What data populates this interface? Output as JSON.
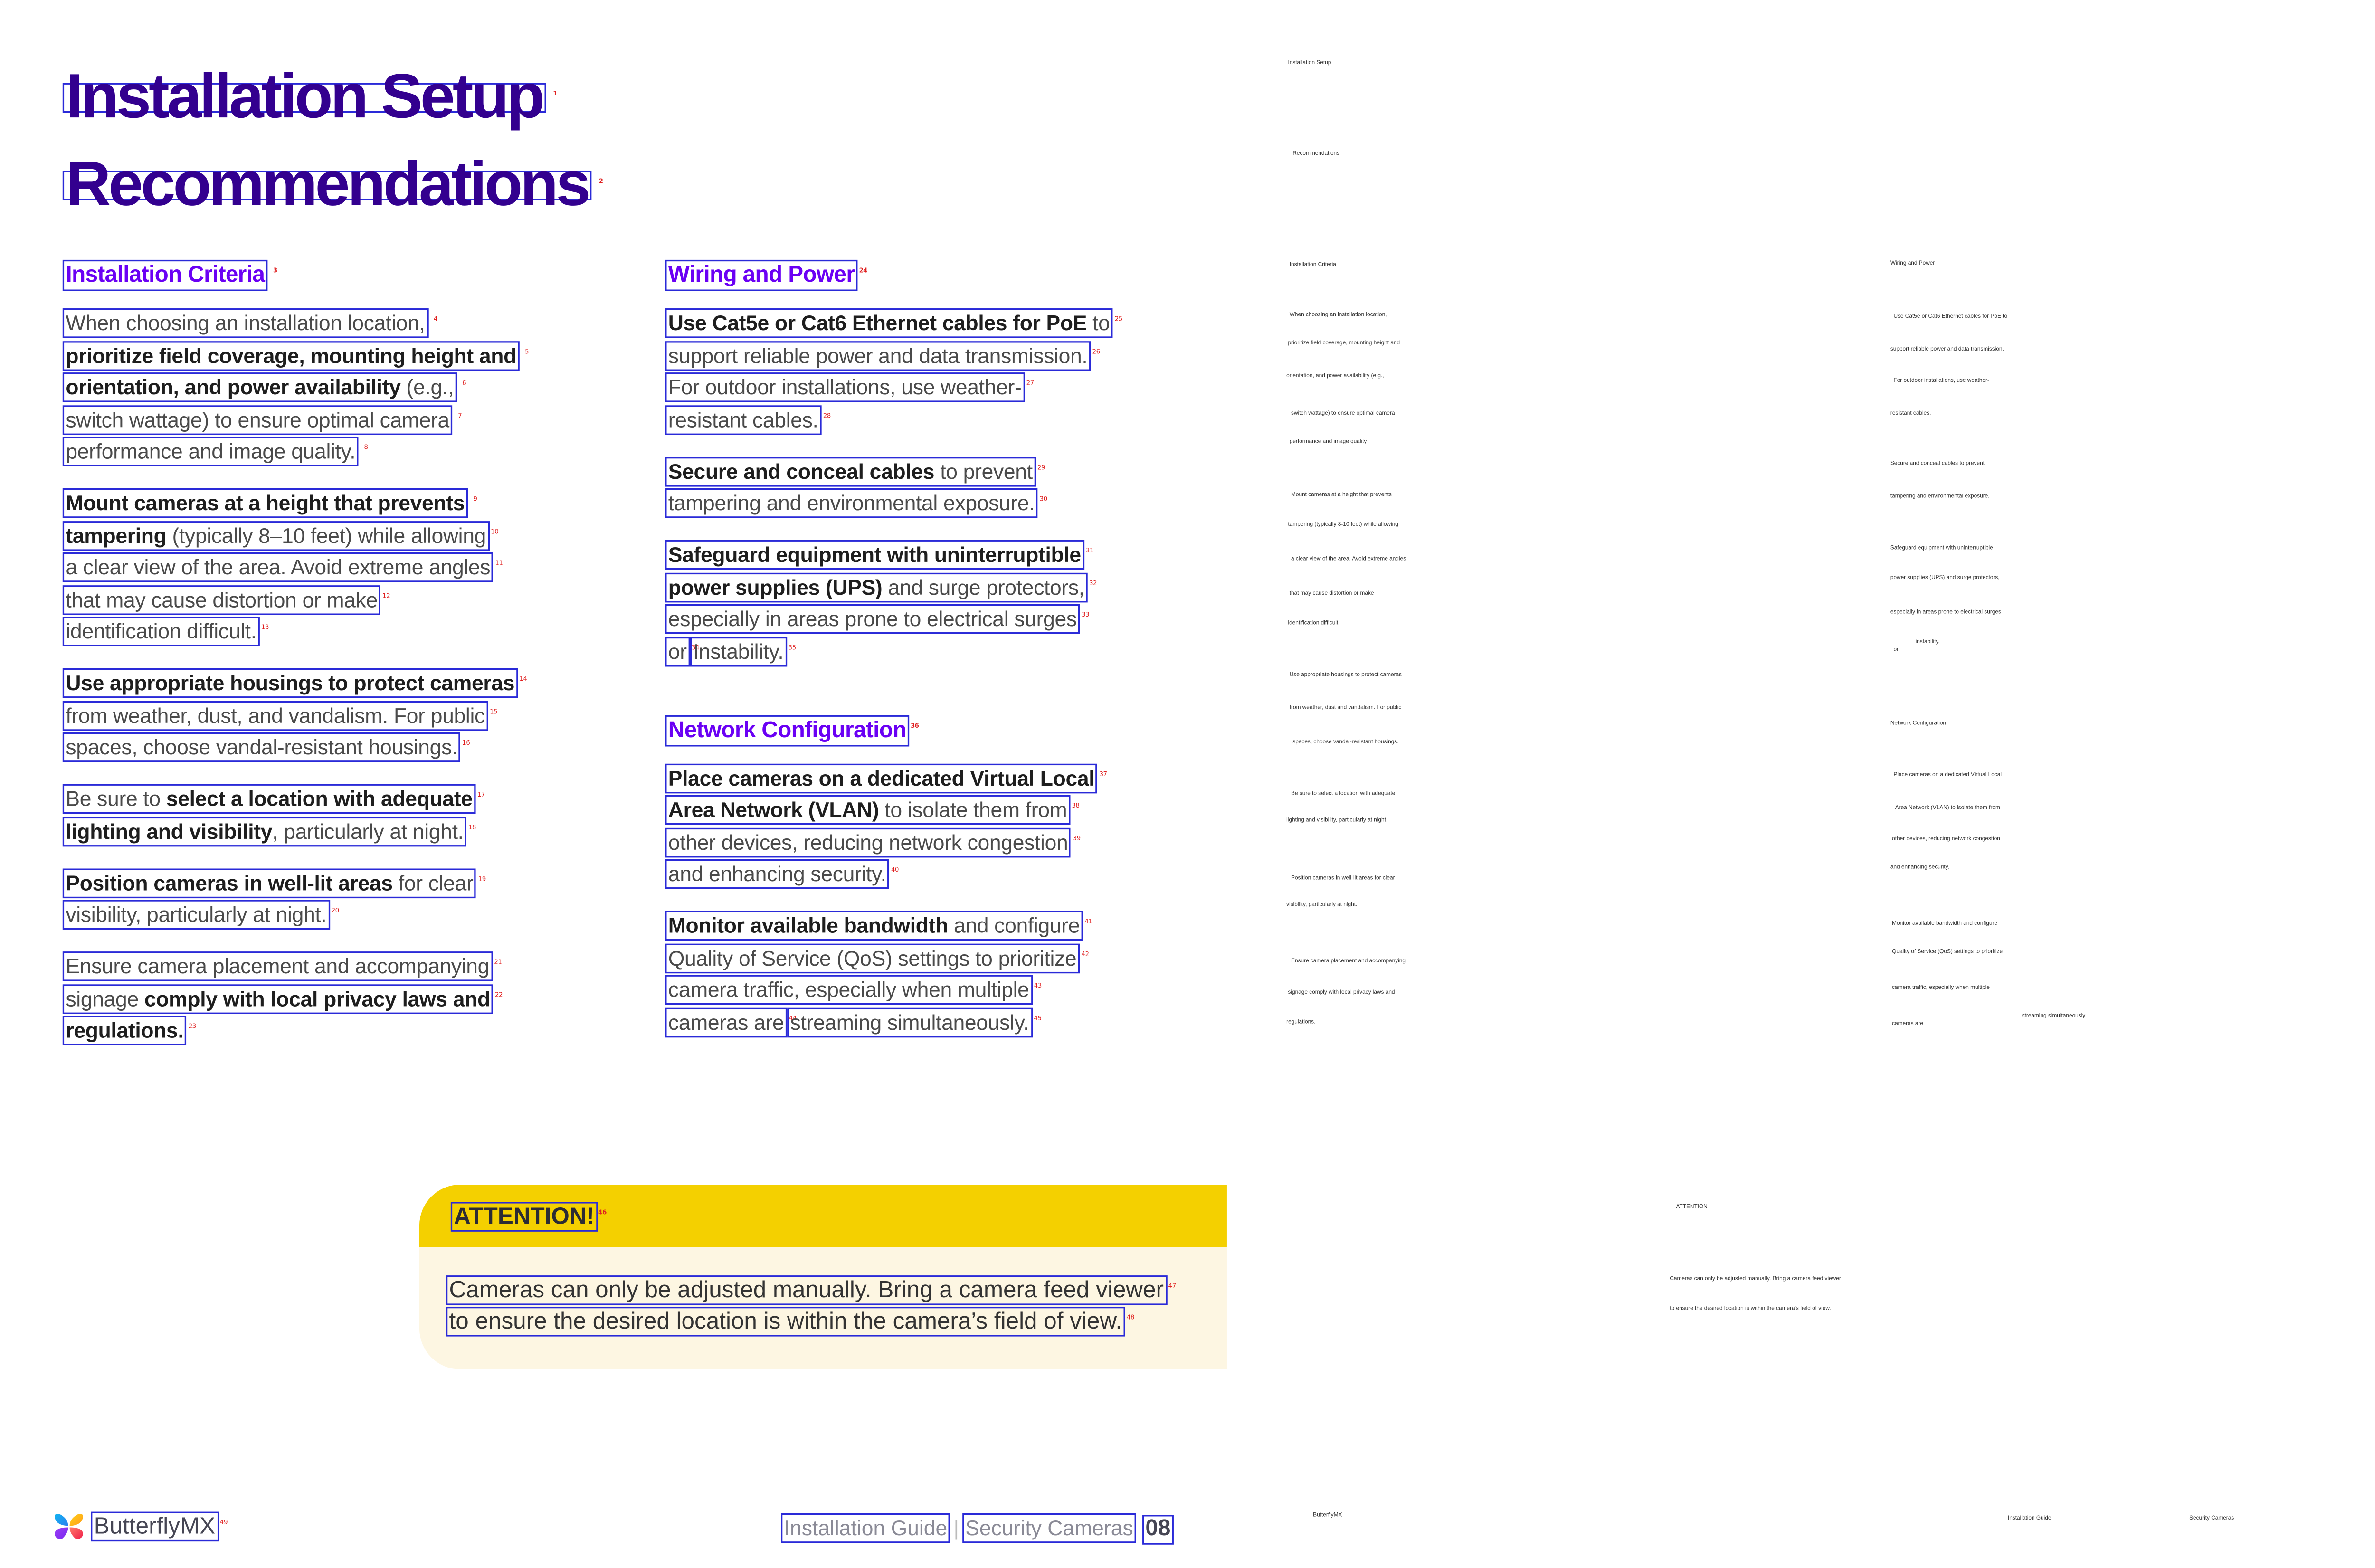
{
  "title": {
    "line1": "Installation Setup",
    "line2": "Recommendations"
  },
  "left_column": {
    "heading": "Installation Criteria",
    "paragraphs": [
      [
        [
          {
            "t": "When choosing an installation location,"
          }
        ],
        [
          {
            "t": "prioritize field coverage, mounting height and",
            "b": 1
          }
        ],
        [
          {
            "t": "orientation, and power availability",
            "b": 1
          },
          {
            "t": " (e.g.,"
          }
        ],
        [
          {
            "t": "switch wattage) to ensure optimal camera"
          }
        ],
        [
          {
            "t": "performance and image quality."
          }
        ]
      ],
      [
        [
          {
            "t": "Mount cameras at a height that prevents",
            "b": 1
          }
        ],
        [
          {
            "t": "tampering",
            "b": 1
          },
          {
            "t": " (typically 8–10 feet) while allowing"
          }
        ],
        [
          {
            "t": "a clear view of the area. Avoid extreme angles"
          }
        ],
        [
          {
            "t": "that may cause distortion or make"
          }
        ],
        [
          {
            "t": "identification difficult."
          }
        ]
      ],
      [
        [
          {
            "t": "Use appropriate housings to protect cameras",
            "b": 1
          }
        ],
        [
          {
            "t": "from weather, dust, and vandalism. For public"
          }
        ],
        [
          {
            "t": "spaces, choose vandal-resistant housings."
          }
        ]
      ],
      [
        [
          {
            "t": "Be sure to "
          },
          {
            "t": "select a location with adequate",
            "b": 1
          }
        ],
        [
          {
            "t": "lighting and visibility",
            "b": 1
          },
          {
            "t": ", particularly at night."
          }
        ]
      ],
      [
        [
          {
            "t": "Position cameras in well-lit areas",
            "b": 1
          },
          {
            "t": " for clear"
          }
        ],
        [
          {
            "t": "visibility, particularly at night."
          }
        ]
      ],
      [
        [
          {
            "t": "Ensure camera placement and accompanying"
          }
        ],
        [
          {
            "t": "signage "
          },
          {
            "t": "comply with local privacy laws and",
            "b": 1
          }
        ],
        [
          {
            "t": "regulations.",
            "b": 1
          }
        ]
      ]
    ]
  },
  "right_column": {
    "sections": [
      {
        "heading": "Wiring and Power",
        "paragraphs": [
          [
            [
              {
                "t": "Use Cat5e or Cat6 Ethernet cables for PoE",
                "b": 1
              },
              {
                "t": " to"
              }
            ],
            [
              {
                "t": "support reliable power and data transmission."
              }
            ],
            [
              {
                "t": "For outdoor installations, use weather-"
              }
            ],
            [
              {
                "t": "resistant cables."
              }
            ]
          ],
          [
            [
              {
                "t": "Secure and conceal cables",
                "b": 1
              },
              {
                "t": " to prevent"
              }
            ],
            [
              {
                "t": "tampering and environmental exposure."
              }
            ]
          ],
          [
            [
              {
                "t": "Safeguard equipment with uninterruptible",
                "b": 1
              }
            ],
            [
              {
                "t": "power supplies (UPS)",
                "b": 1
              },
              {
                "t": " and surge protectors,"
              }
            ],
            [
              {
                "t": "especially in areas prone to electrical surges"
              }
            ],
            [
              {
                "t": "or"
              },
              "|",
              {
                "t": "Instability."
              }
            ]
          ]
        ]
      },
      {
        "heading": "Network Configuration",
        "paragraphs": [
          [
            [
              {
                "t": "Place cameras on a dedicated Virtual Local",
                "b": 1
              }
            ],
            [
              {
                "t": "Area Network (VLAN)",
                "b": 1
              },
              {
                "t": " to isolate them from"
              }
            ],
            [
              {
                "t": "other devices, reducing network congestion"
              }
            ],
            [
              {
                "t": "and enhancing security."
              }
            ]
          ],
          [
            [
              {
                "t": "Monitor available bandwidth",
                "b": 1
              },
              {
                "t": " and configure"
              }
            ],
            [
              {
                "t": "Quality of Service (QoS) settings to prioritize"
              }
            ],
            [
              {
                "t": "camera traffic, especially when multiple"
              }
            ],
            [
              {
                "t": "cameras are"
              },
              "|",
              {
                "t": "streaming simultaneously."
              }
            ]
          ]
        ]
      }
    ]
  },
  "attention": {
    "label": "ATTENTION!",
    "line1": "Cameras can only be adjusted manually. Bring a camera feed viewer",
    "line2": "to ensure the desired location is within the camera’s field of view.",
    "header_color": "#f4d000",
    "body_color": "#fdf6e2"
  },
  "footer": {
    "brand": "ButterflyMX",
    "logo_icon": "butterfly-logo-icon",
    "guide": "Installation Guide",
    "separator": "|",
    "section": "Security Cameras",
    "page": "08"
  },
  "ocr_text": [
    "Installation Setup",
    "Recommendations",
    "Installation Criteria",
    "Wiring and Power",
    "When choosing an installation location,",
    "prioritize field coverage, mounting height and",
    "orientation, and power availability (e.g.,",
    "switch wattage) to ensure optimal camera",
    "performance and image quality",
    "Mount cameras at a height that prevents",
    "tampering (typically 8-10 feet) while allowing",
    "a clear view of the area. Avoid extreme angles",
    "that may cause distortion or make",
    "identification difficult.",
    "Use appropriate housings to protect cameras",
    "from weather, dust and vandalism. For public",
    "spaces, choose vandal-resistant housings.",
    "Be sure to select a location with adequate",
    "lighting and visibility, particularly at night.",
    "Position cameras in well-lit areas for clear",
    "visibility, particularly at night.",
    "Ensure camera placement and accompanying",
    "signage comply with local privacy laws and",
    "regulations.",
    "Use Cat5e or Cat6 Ethernet cables for PoE to",
    "support reliable power and data transmission.",
    "For outdoor installations, use weather-",
    "resistant cables.",
    "Secure and conceal cables to prevent",
    "tampering and environmental exposure.",
    "Safeguard equipment with uninterruptible",
    "power supplies (UPS) and surge protectors,",
    "especially in areas prone to electrical surges",
    "instability.",
    "or",
    "Network Configuration",
    "Place cameras on a dedicated Virtual Local",
    "Area Network (VLAN) to isolate them from",
    "other devices, reducing network congestion",
    "and enhancing security.",
    "Monitor available bandwidth and configure",
    "Quality of Service (QoS) settings to prioritize",
    "camera traffic, especially when multiple",
    "cameras are",
    "streaming simultaneously.",
    "ATTENTION",
    "Cameras can only be adjusted manually. Bring a camera feed viewer",
    "to ensure the desired location is within the camera's field of view.",
    "ButterflyMX",
    "Installation Guide",
    "Security Cameras",
    "08"
  ]
}
